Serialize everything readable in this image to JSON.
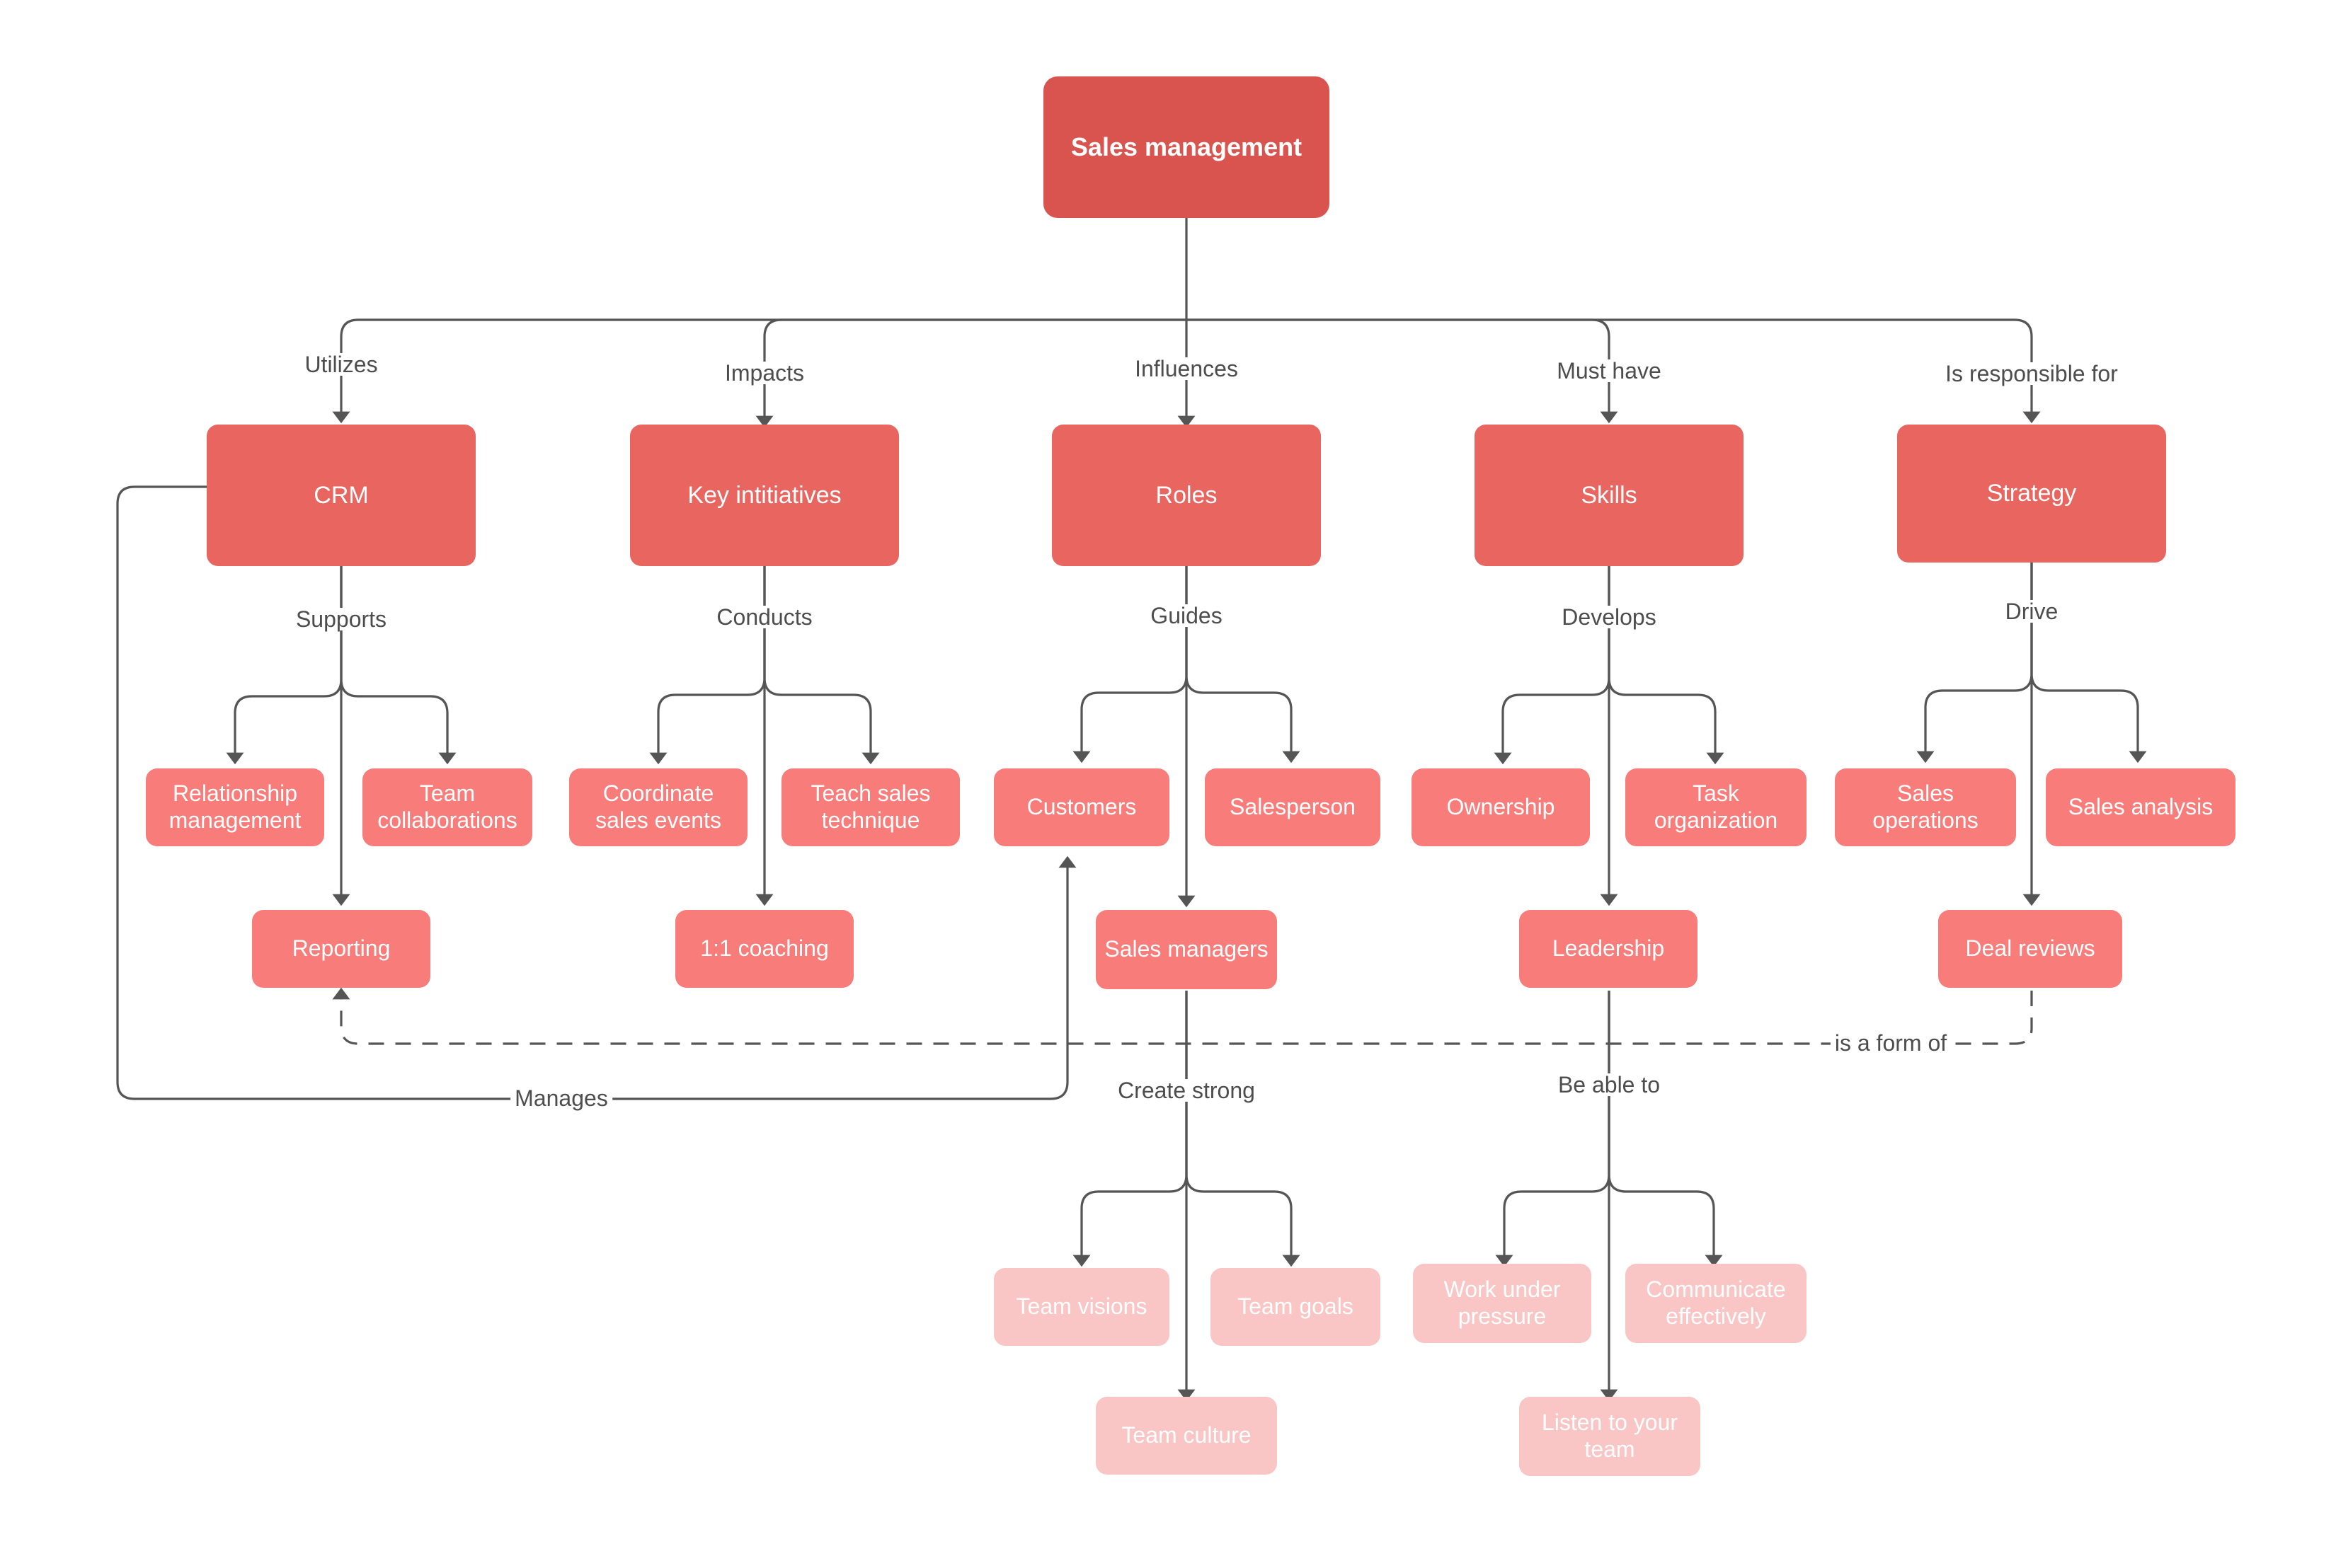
{
  "diagram": {
    "title": "Sales management mind map",
    "colors": {
      "root": "#d9534f",
      "level1": "#e86560",
      "level2": "#f87c7a",
      "level3": "#f87c7a",
      "level4": "#fac5c5",
      "line": "#555555",
      "label_text": "#4d4d4d",
      "node_text": "#ffffff",
      "background": "#ffffff"
    },
    "nodes": {
      "root": "Sales management",
      "crm": "CRM",
      "key_initiatives": "Key intitiatives",
      "roles": "Roles",
      "skills": "Skills",
      "strategy": "Strategy",
      "relationship_management": "Relationship management",
      "team_collaborations": "Team collaborations",
      "reporting": "Reporting",
      "coordinate_sales_events": "Coordinate sales events",
      "teach_sales_technique": "Teach sales technique",
      "one_on_one_coaching": "1:1 coaching",
      "customers": "Customers",
      "salesperson": "Salesperson",
      "sales_managers": "Sales managers",
      "ownership": "Ownership",
      "task_organization": "Task organization",
      "leadership": "Leadership",
      "sales_operations": "Sales operations",
      "sales_analysis": "Sales analysis",
      "deal_reviews": "Deal reviews",
      "team_visions": "Team visions",
      "team_goals": "Team goals",
      "team_culture": "Team culture",
      "work_under_pressure": "Work under pressure",
      "communicate_effectively": "Communicate effectively",
      "listen_to_your_team": "Listen to your team"
    },
    "edge_labels": {
      "utilizes": "Utilizes",
      "impacts": "Impacts",
      "influences": "Influences",
      "must_have": "Must have",
      "is_responsible_for": "Is responsible for",
      "supports": "Supports",
      "conducts": "Conducts",
      "guides": "Guides",
      "develops": "Develops",
      "drive": "Drive",
      "manages": "Manages",
      "is_a_form_of": "is a form of",
      "create_strong": "Create strong",
      "be_able_to": "Be able to"
    }
  }
}
